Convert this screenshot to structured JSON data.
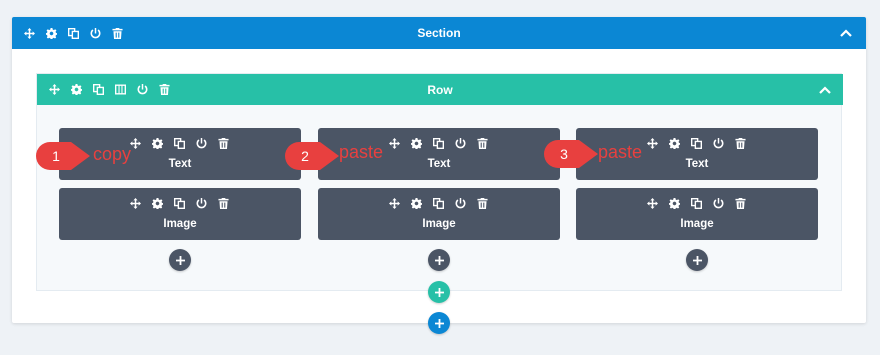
{
  "section": {
    "title": "Section"
  },
  "row": {
    "title": "Row"
  },
  "columns": [
    {
      "modules": [
        {
          "label": "Text"
        },
        {
          "label": "Image"
        }
      ]
    },
    {
      "modules": [
        {
          "label": "Text"
        },
        {
          "label": "Image"
        }
      ]
    },
    {
      "modules": [
        {
          "label": "Text"
        },
        {
          "label": "Image"
        }
      ]
    }
  ],
  "annotations": [
    {
      "number": "1",
      "text": "copy"
    },
    {
      "number": "2",
      "text": "paste"
    },
    {
      "number": "3",
      "text": "paste"
    }
  ],
  "icons": {
    "section_controls": [
      "move-icon",
      "settings-icon",
      "duplicate-icon",
      "toggle-icon",
      "delete-icon"
    ],
    "row_controls": [
      "move-icon",
      "settings-icon",
      "duplicate-icon",
      "columns-icon",
      "toggle-icon",
      "delete-icon"
    ],
    "module_controls": [
      "move-icon",
      "settings-icon",
      "duplicate-icon",
      "toggle-icon",
      "delete-icon"
    ],
    "add_buttons": [
      "add-module-icon",
      "add-row-icon",
      "add-section-icon"
    ]
  },
  "colors": {
    "section_bar": "#0b87d4",
    "row_bar": "#27c0a7",
    "module": "#4b5565",
    "annotation_red": "#e8403f",
    "background": "#eef2f6"
  }
}
